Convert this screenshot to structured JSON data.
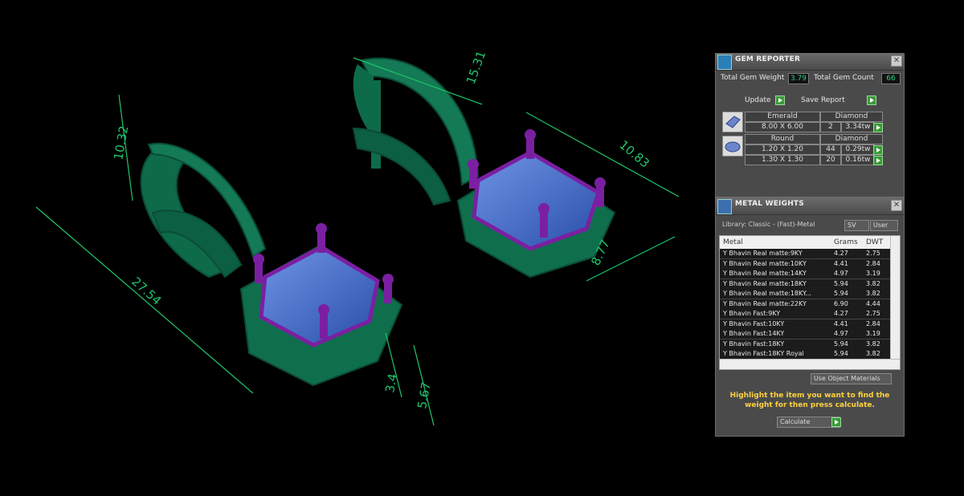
{
  "viewport": {
    "dimensions": [
      "10.32",
      "27.54",
      "15.31",
      "10.83",
      "8.77",
      "3.4",
      "5.67"
    ]
  },
  "gem_reporter": {
    "title": "GEM REPORTER",
    "total_gem_weight_label": "Total Gem Weight",
    "total_gem_weight": "3.79",
    "total_gem_count_label": "Total Gem Count",
    "total_gem_count": "66",
    "update_label": "Update",
    "save_report_label": "Save Report",
    "groups": [
      {
        "icon": "emerald-cut-gem-icon",
        "shape": "Emerald",
        "stone": "Diamond",
        "rows": [
          {
            "size": "8.00 X 6.00",
            "count": "2",
            "weight": "3.34tw"
          }
        ]
      },
      {
        "icon": "round-gem-icon",
        "shape": "Round",
        "stone": "Diamond",
        "rows": [
          {
            "size": "1.20 X 1.20",
            "count": "44",
            "weight": "0.29tw"
          },
          {
            "size": "1.30 X 1.30",
            "count": "20",
            "weight": "0.16tw"
          }
        ]
      }
    ]
  },
  "metal_weights": {
    "title": "METAL WEIGHTS",
    "library": "Library: Classic - (Fast)-Metal",
    "sv_label": "SV",
    "user_label": "User",
    "columns": [
      "Metal",
      "Grams",
      "DWT"
    ],
    "rows": [
      [
        "Y Bhavin Real matte:9KY",
        "4.27",
        "2.75"
      ],
      [
        "Y Bhavin Real matte:10KY",
        "4.41",
        "2.84"
      ],
      [
        "Y Bhavin Real matte:14KY",
        "4.97",
        "3.19"
      ],
      [
        "Y Bhavin Real matte:18KY",
        "5.94",
        "3.82"
      ],
      [
        "Y Bhavin Real matte:18KY...",
        "5.94",
        "3.82"
      ],
      [
        "Y Bhavin Real matte:22KY",
        "6.90",
        "4.44"
      ],
      [
        "Y Bhavin Fast:9KY",
        "4.27",
        "2.75"
      ],
      [
        "Y Bhavin Fast:10KY",
        "4.41",
        "2.84"
      ],
      [
        "Y Bhavin Fast:14KY",
        "4.97",
        "3.19"
      ],
      [
        "Y Bhavin Fast:18KY",
        "5.94",
        "3.82"
      ],
      [
        "Y Bhavin Fast:18KY Royal",
        "5.94",
        "3.82"
      ]
    ],
    "use_object_materials_label": "Use Object Materials",
    "instruction": "Highlight the item you want to find the weight for then press calculate.",
    "calculate_label": "Calculate"
  },
  "colors": {
    "metal_green": "#0e6b4a",
    "prong_purple": "#7b1fa2",
    "stone_blue": "#3f67c8",
    "dimension": "#1fc46a",
    "instruction": "#ffd23f"
  }
}
